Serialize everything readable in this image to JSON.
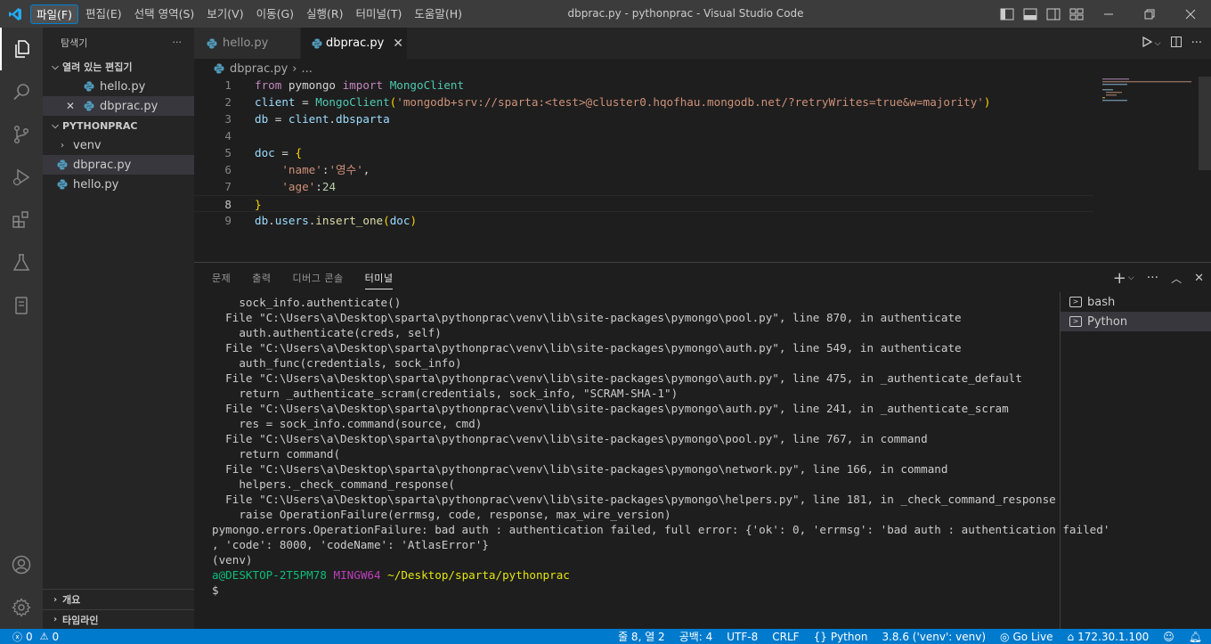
{
  "titlebar": {
    "menu": [
      "파일(F)",
      "편집(E)",
      "선택 영역(S)",
      "보기(V)",
      "이동(G)",
      "실행(R)",
      "터미널(T)",
      "도움말(H)"
    ],
    "title": "dbprac.py - pythonprac - Visual Studio Code"
  },
  "sidebar": {
    "header": "탐색기",
    "more": "···",
    "open_editors_label": "열려 있는 편집기",
    "open_editors": [
      {
        "name": "hello.py"
      },
      {
        "name": "dbprac.py",
        "close": "✕"
      }
    ],
    "project_label": "PYTHONPRAC",
    "tree": [
      {
        "name": "venv",
        "type": "folder"
      },
      {
        "name": "dbprac.py",
        "type": "file"
      },
      {
        "name": "hello.py",
        "type": "file"
      }
    ],
    "outline_label": "개요",
    "timeline_label": "타임라인"
  },
  "tabs": [
    {
      "label": "hello.py",
      "active": false
    },
    {
      "label": "dbprac.py",
      "active": true,
      "close": "✕"
    }
  ],
  "breadcrumb": {
    "file": "dbprac.py",
    "sep": "›",
    "rest": "..."
  },
  "code": {
    "line_numbers": [
      "1",
      "2",
      "3",
      "4",
      "5",
      "6",
      "7",
      "8",
      "9"
    ],
    "current_line": 8,
    "lines": [
      [
        [
          "kw",
          "from"
        ],
        [
          "plain",
          " pymongo "
        ],
        [
          "kw",
          "import"
        ],
        [
          "plain",
          " "
        ],
        [
          "cls",
          "MongoClient"
        ]
      ],
      [
        [
          "var",
          "client"
        ],
        [
          "plain",
          " = "
        ],
        [
          "cls",
          "MongoClient"
        ],
        [
          "br",
          "("
        ],
        [
          "str",
          "'mongodb+srv://sparta:<test>@cluster0.hqofhau.mongodb.net/?retryWrites=true&w=majority'"
        ],
        [
          "br",
          ")"
        ]
      ],
      [
        [
          "var",
          "db"
        ],
        [
          "plain",
          " = "
        ],
        [
          "var",
          "client"
        ],
        [
          "plain",
          "."
        ],
        [
          "var",
          "dbsparta"
        ]
      ],
      [
        [
          "plain",
          ""
        ]
      ],
      [
        [
          "var",
          "doc"
        ],
        [
          "plain",
          " = "
        ],
        [
          "br",
          "{"
        ]
      ],
      [
        [
          "plain",
          "    "
        ],
        [
          "str",
          "'name'"
        ],
        [
          "plain",
          ":"
        ],
        [
          "str",
          "'영수'"
        ],
        [
          "plain",
          ","
        ]
      ],
      [
        [
          "plain",
          "    "
        ],
        [
          "str",
          "'age'"
        ],
        [
          "plain",
          ":"
        ],
        [
          "num",
          "24"
        ]
      ],
      [
        [
          "br",
          "}"
        ]
      ],
      [
        [
          "var",
          "db"
        ],
        [
          "plain",
          "."
        ],
        [
          "var",
          "users"
        ],
        [
          "plain",
          "."
        ],
        [
          "fn",
          "insert_one"
        ],
        [
          "br",
          "("
        ],
        [
          "var",
          "doc"
        ],
        [
          "br",
          ")"
        ]
      ]
    ]
  },
  "panel": {
    "tabs": [
      "문제",
      "출력",
      "디버그 콘솔",
      "터미널"
    ],
    "active_tab": "터미널",
    "terminals": [
      {
        "name": "bash",
        "selected": false
      },
      {
        "name": "Python",
        "selected": true
      }
    ],
    "lines": [
      [
        [
          "plain",
          "    sock_info.authenticate()"
        ]
      ],
      [
        [
          "plain",
          "  File \"C:\\Users\\a\\Desktop\\sparta\\pythonprac\\venv\\lib\\site-packages\\pymongo\\pool.py\", line 870, in authenticate"
        ]
      ],
      [
        [
          "plain",
          "    auth.authenticate(creds, self)"
        ]
      ],
      [
        [
          "plain",
          "  File \"C:\\Users\\a\\Desktop\\sparta\\pythonprac\\venv\\lib\\site-packages\\pymongo\\auth.py\", line 549, in authenticate"
        ]
      ],
      [
        [
          "plain",
          "    auth_func(credentials, sock_info)"
        ]
      ],
      [
        [
          "plain",
          "  File \"C:\\Users\\a\\Desktop\\sparta\\pythonprac\\venv\\lib\\site-packages\\pymongo\\auth.py\", line 475, in _authenticate_default"
        ]
      ],
      [
        [
          "plain",
          "    return _authenticate_scram(credentials, sock_info, \"SCRAM-SHA-1\")"
        ]
      ],
      [
        [
          "plain",
          "  File \"C:\\Users\\a\\Desktop\\sparta\\pythonprac\\venv\\lib\\site-packages\\pymongo\\auth.py\", line 241, in _authenticate_scram"
        ]
      ],
      [
        [
          "plain",
          "    res = sock_info.command(source, cmd)"
        ]
      ],
      [
        [
          "plain",
          "  File \"C:\\Users\\a\\Desktop\\sparta\\pythonprac\\venv\\lib\\site-packages\\pymongo\\pool.py\", line 767, in command"
        ]
      ],
      [
        [
          "plain",
          "    return command("
        ]
      ],
      [
        [
          "plain",
          "  File \"C:\\Users\\a\\Desktop\\sparta\\pythonprac\\venv\\lib\\site-packages\\pymongo\\network.py\", line 166, in command"
        ]
      ],
      [
        [
          "plain",
          "    helpers._check_command_response("
        ]
      ],
      [
        [
          "plain",
          "  File \"C:\\Users\\a\\Desktop\\sparta\\pythonprac\\venv\\lib\\site-packages\\pymongo\\helpers.py\", line 181, in _check_command_response"
        ]
      ],
      [
        [
          "plain",
          "    raise OperationFailure(errmsg, code, response, max_wire_version)"
        ]
      ],
      [
        [
          "plain",
          "pymongo.errors.OperationFailure: bad auth : authentication failed, full error: {'ok': 0, 'errmsg': 'bad auth : authentication failed'"
        ]
      ],
      [
        [
          "plain",
          ", 'code': 8000, 'codeName': 'AtlasError'}"
        ]
      ],
      [
        [
          "plain",
          "(venv)"
        ]
      ],
      [
        [
          "t-green",
          "a@DESKTOP-2T5PM78"
        ],
        [
          "plain",
          " "
        ],
        [
          "t-magenta",
          "MINGW64"
        ],
        [
          "plain",
          " "
        ],
        [
          "t-yellow",
          "~/Desktop/sparta/pythonprac"
        ]
      ],
      [
        [
          "plain",
          "$"
        ]
      ]
    ]
  },
  "statusbar": {
    "errors": "0",
    "warnings": "0",
    "position": "줄 8, 열 2",
    "spaces": "공백: 4",
    "encoding": "UTF-8",
    "eol": "CRLF",
    "language": "Python",
    "interpreter": "3.8.6 ('venv': venv)",
    "golive": "Go Live",
    "ip": "172.30.1.100"
  },
  "colors": {
    "accent": "#007acc",
    "titlebar": "#3c3c3c",
    "sidebar": "#252526",
    "editor": "#1e1e1e"
  }
}
